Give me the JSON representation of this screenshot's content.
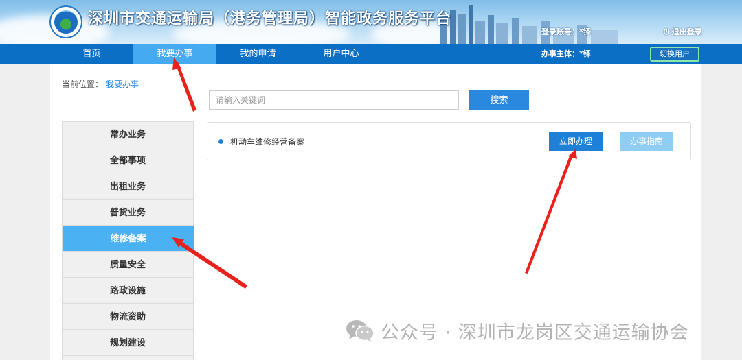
{
  "header": {
    "title": "深圳市交通运输局（港务管理局）智能政务服务平台",
    "login_account": "登录账号：*铎",
    "logout": "退出登录"
  },
  "nav": {
    "items": [
      {
        "label": "首页"
      },
      {
        "label": "我要办事",
        "active": true
      },
      {
        "label": "我的申请"
      },
      {
        "label": "用户中心"
      }
    ],
    "subject": "办事主体：*铎",
    "switch_user": "切换用户"
  },
  "breadcrumb": {
    "prefix": "当前位置：",
    "current": "我要办事"
  },
  "search": {
    "placeholder": "请输入关键词",
    "value": "",
    "button": "搜索"
  },
  "sidebar": {
    "items": [
      {
        "label": "常办业务"
      },
      {
        "label": "全部事项"
      },
      {
        "label": "出租业务"
      },
      {
        "label": "普货业务"
      },
      {
        "label": "维修备案",
        "active": true
      },
      {
        "label": "质量安全"
      },
      {
        "label": "路政设施"
      },
      {
        "label": "物流资助"
      },
      {
        "label": "规划建设"
      }
    ]
  },
  "services": [
    {
      "name": "机动车维修经营备案",
      "handle": "立即办理",
      "guide": "办事指南"
    }
  ],
  "watermark": {
    "text": "公众号 · 深圳市龙岗区交通运输协会"
  },
  "colors": {
    "nav_bg": "#0c6fc6",
    "nav_active": "#45aaf0",
    "primary_button": "#1f80d8",
    "secondary_button": "#8fcdf3",
    "sidebar_active": "#4ab2f2",
    "annotation_arrow": "#e8221b"
  }
}
